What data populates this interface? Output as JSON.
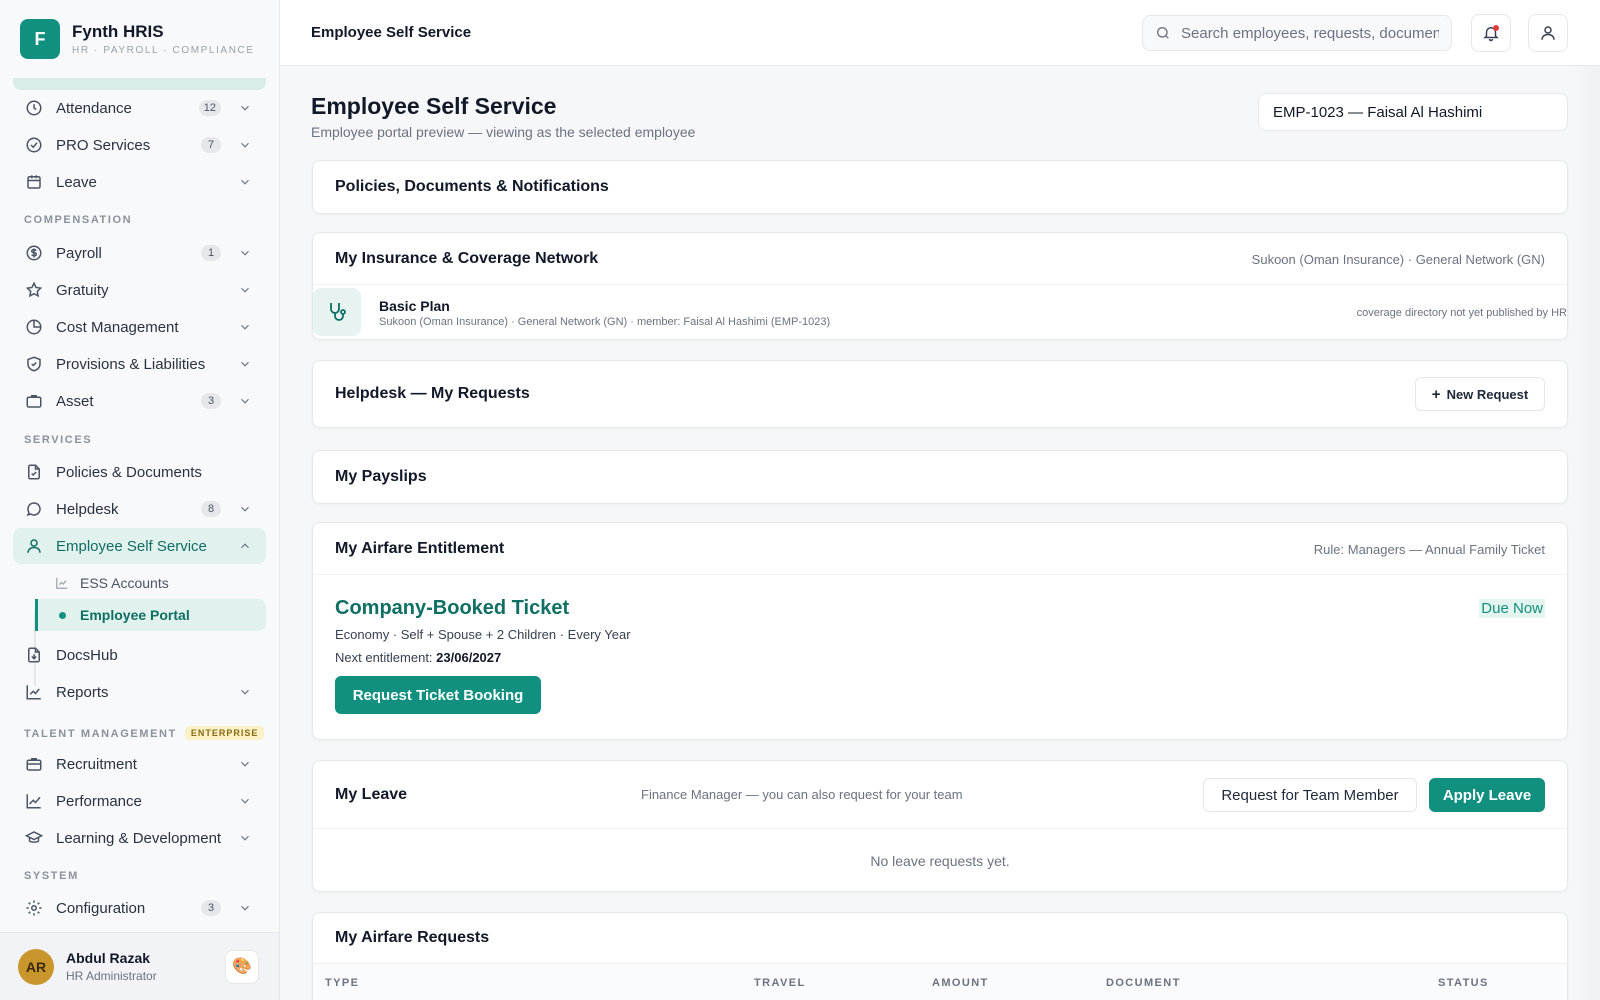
{
  "app": {
    "name": "Fynth HRIS",
    "tagline": "HR · PAYROLL · COMPLIANCE",
    "logo_letter": "F",
    "accent_color": "#11907f"
  },
  "sidebar": {
    "items_top": [
      {
        "label": "Attendance",
        "badge": "12",
        "icon": "clock-icon"
      },
      {
        "label": "PRO Services",
        "badge": "7",
        "icon": "check-circle-icon"
      },
      {
        "label": "Leave",
        "badge": "",
        "icon": "calendar-icon"
      }
    ],
    "compensation_label": "COMPENSATION",
    "compensation": [
      {
        "label": "Payroll",
        "badge": "1",
        "icon": "dollar-icon"
      },
      {
        "label": "Gratuity",
        "badge": "",
        "icon": "star-icon"
      },
      {
        "label": "Cost Management",
        "badge": "",
        "icon": "pie-chart-icon"
      },
      {
        "label": "Provisions & Liabilities",
        "badge": "",
        "icon": "shield-icon"
      },
      {
        "label": "Asset",
        "badge": "3",
        "icon": "briefcase-icon"
      }
    ],
    "services_label": "SERVICES",
    "services": [
      {
        "label": "Policies & Documents",
        "badge": "",
        "icon": "file-icon"
      },
      {
        "label": "Helpdesk",
        "badge": "8",
        "icon": "chat-icon"
      },
      {
        "label": "Employee Self Service",
        "badge": "",
        "icon": "user-icon"
      }
    ],
    "ess_sub": [
      {
        "label": "ESS Accounts"
      },
      {
        "label": "Employee Portal"
      }
    ],
    "after_services": [
      {
        "label": "DocsHub",
        "icon": "download-file-icon"
      },
      {
        "label": "Reports",
        "icon": "chart-icon"
      }
    ],
    "talent_label": "TALENT MANAGEMENT",
    "talent_badge": "ENTERPRISE",
    "talent": [
      {
        "label": "Recruitment",
        "icon": "briefcase-icon"
      },
      {
        "label": "Performance",
        "icon": "trend-icon"
      },
      {
        "label": "Learning & Development",
        "icon": "graduation-cap-icon"
      }
    ],
    "system_label": "SYSTEM",
    "system": [
      {
        "label": "Configuration",
        "badge": "3",
        "icon": "gear-icon"
      }
    ]
  },
  "user": {
    "initials": "AR",
    "name": "Abdul Razak",
    "role": "HR Administrator"
  },
  "topbar": {
    "title": "Employee Self Service",
    "search_placeholder": "Search employees, requests, documents..."
  },
  "page": {
    "title": "Employee Self Service",
    "subtitle": "Employee portal preview — viewing as the selected employee",
    "employee_selected": "EMP-1023 — Faisal Al Hashimi"
  },
  "policies": {
    "title": "Policies, Documents & Notifications"
  },
  "insurance": {
    "title": "My Insurance & Coverage Network",
    "meta": "Sukoon (Oman Insurance) · General Network (GN)",
    "plan": "Basic Plan",
    "detail": "Sukoon (Oman Insurance) · General Network (GN) · member: Faisal Al Hashimi (EMP-1023)",
    "note": "coverage directory not yet published by HR"
  },
  "helpdesk": {
    "title": "Helpdesk — My Requests",
    "new_request": "New Request"
  },
  "payslips": {
    "title": "My Payslips"
  },
  "airfare": {
    "title": "My Airfare Entitlement",
    "rule": "Rule: Managers — Annual Family Ticket",
    "ticket_type": "Company-Booked Ticket",
    "details": "Economy · Self + Spouse + 2 Children · Every Year",
    "next_label": "Next entitlement:",
    "next_date": "23/06/2027",
    "status": "Due Now",
    "request_button": "Request Ticket Booking"
  },
  "leave": {
    "title": "My Leave",
    "note": "Finance Manager — you can also request for your team",
    "team_button": "Request for Team Member",
    "apply_button": "Apply Leave",
    "empty": "No leave requests yet."
  },
  "airfare_requests": {
    "title": "My Airfare Requests",
    "columns": [
      "TYPE",
      "TRAVEL",
      "AMOUNT",
      "DOCUMENT",
      "STATUS"
    ]
  }
}
